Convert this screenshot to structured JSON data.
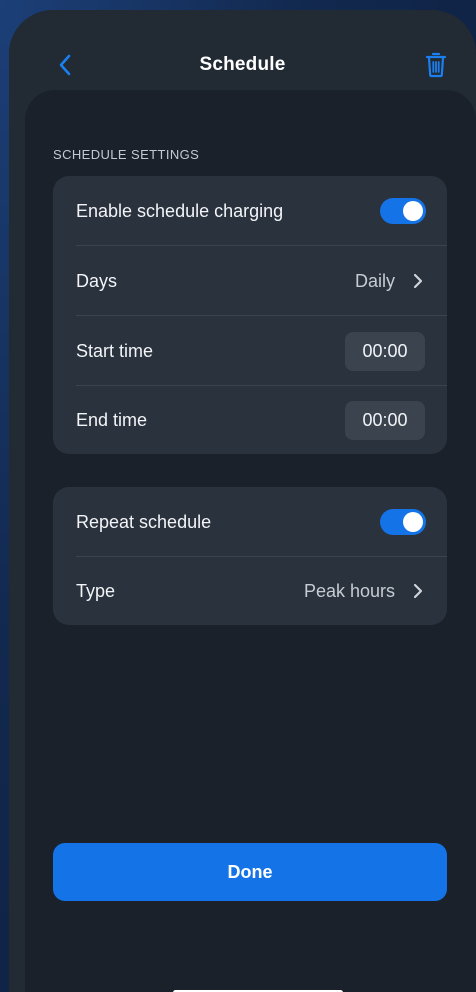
{
  "header": {
    "title": "Schedule",
    "back_icon": "chevron-left-icon",
    "delete_icon": "trash-icon"
  },
  "section": {
    "title": "SCHEDULE SETTINGS"
  },
  "settings": {
    "enable_label": "Enable schedule charging",
    "enable_on": true,
    "days_label": "Days",
    "days_value": "Daily",
    "start_label": "Start time",
    "start_value": "00:00",
    "end_label": "End time",
    "end_value": "00:00"
  },
  "repeat": {
    "repeat_label": "Repeat schedule",
    "repeat_on": true,
    "type_label": "Type",
    "type_value": "Peak hours"
  },
  "actions": {
    "done_label": "Done"
  },
  "colors": {
    "accent": "#1473e6",
    "background": "#1a212b",
    "card": "#2a323d"
  }
}
